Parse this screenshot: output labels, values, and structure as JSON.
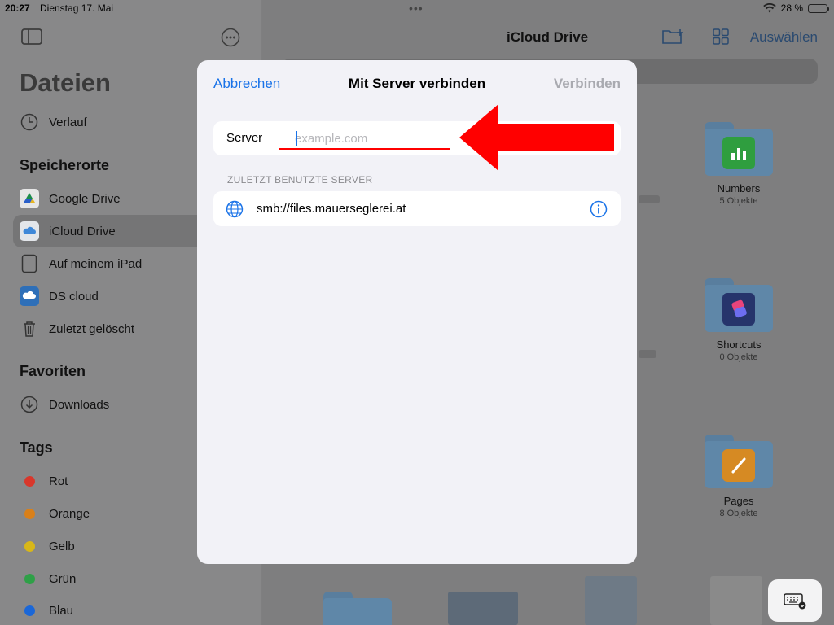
{
  "status_bar": {
    "time": "20:27",
    "date": "Dienstag 17. Mai",
    "battery_text": "28 %",
    "battery_level": 0.28
  },
  "sidebar": {
    "title": "Dateien",
    "recent": {
      "label": "Verlauf",
      "icon": "clock-icon"
    },
    "locations_header": "Speicherorte",
    "locations": [
      {
        "label": "Google Drive",
        "icon": "google-drive-icon",
        "selected": false
      },
      {
        "label": "iCloud Drive",
        "icon": "icloud-icon",
        "selected": true
      },
      {
        "label": "Auf meinem iPad",
        "icon": "ipad-icon",
        "selected": false
      },
      {
        "label": "DS cloud",
        "icon": "ds-cloud-icon",
        "selected": false
      },
      {
        "label": "Zuletzt gelöscht",
        "icon": "trash-icon",
        "selected": false
      }
    ],
    "favorites_header": "Favoriten",
    "favorites": [
      {
        "label": "Downloads",
        "icon": "download-icon"
      }
    ],
    "tags_header": "Tags",
    "tags": [
      {
        "label": "Rot",
        "color": "#d9372b"
      },
      {
        "label": "Orange",
        "color": "#d9801a"
      },
      {
        "label": "Gelb",
        "color": "#d8b718"
      },
      {
        "label": "Grün",
        "color": "#2ea047"
      },
      {
        "label": "Blau",
        "color": "#1a67d8"
      }
    ]
  },
  "main": {
    "title": "iCloud Drive",
    "select_label": "Auswählen",
    "folders": [
      {
        "name": "Numbers",
        "count": "5 Objekte",
        "app_color": "#2f9e3f"
      },
      {
        "name": "Shortcuts",
        "count": "0 Objekte",
        "app_color": "#26346b"
      },
      {
        "name": "Pages",
        "count": "8 Objekte",
        "app_color": "#d68a23"
      }
    ]
  },
  "dialog": {
    "cancel_label": "Abbrechen",
    "title": "Mit Server verbinden",
    "confirm_label": "Verbinden",
    "server_label": "Server",
    "server_value": "",
    "server_placeholder": "example.com",
    "recent_header": "ZULETZT BENUTZTE SERVER",
    "recent_servers": [
      "smb://files.mauerseglerei.at"
    ]
  },
  "colors": {
    "accent": "#1a73e8",
    "annotation": "#ff0000"
  }
}
